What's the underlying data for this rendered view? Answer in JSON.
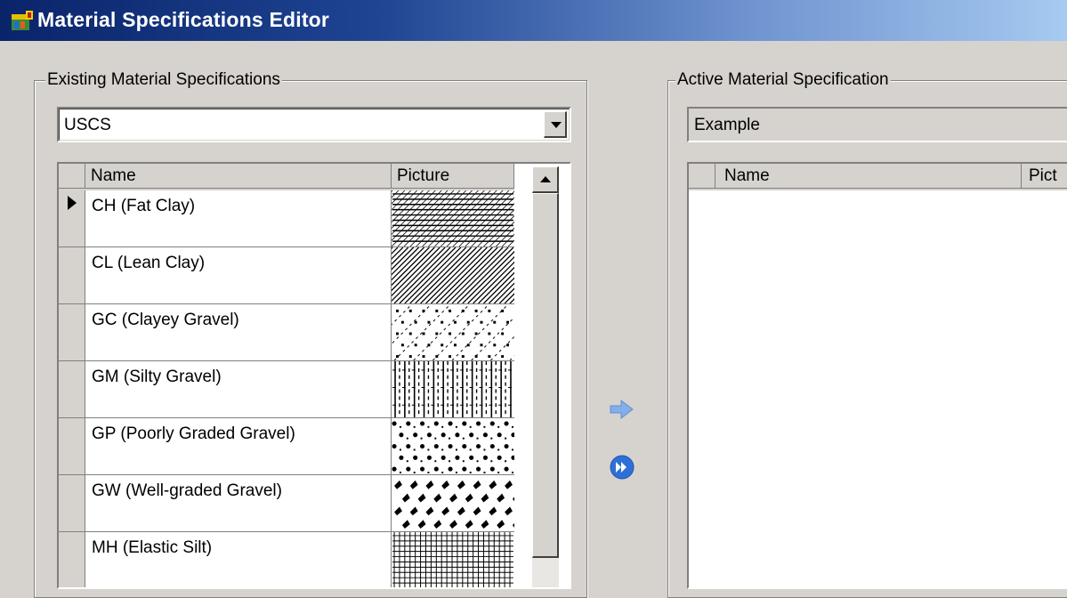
{
  "window": {
    "title": "Material Specifications Editor",
    "icon": "app-icon"
  },
  "existing": {
    "group_label": "Existing Material Specifications",
    "combo_value": "USCS",
    "columns": [
      "Name",
      "Picture"
    ],
    "rows": [
      {
        "name": "CH (Fat Clay)",
        "pattern": "horizontal-hatch",
        "selected": true
      },
      {
        "name": "CL (Lean Clay)",
        "pattern": "diagonal-hatch"
      },
      {
        "name": "GC (Clayey Gravel)",
        "pattern": "diagonal-dots"
      },
      {
        "name": "GM (Silty Gravel)",
        "pattern": "vertical-dashes"
      },
      {
        "name": "GP (Poorly Graded Gravel)",
        "pattern": "scattered-dots"
      },
      {
        "name": "GW (Well-graded Gravel)",
        "pattern": "scattered-blobs"
      },
      {
        "name": "MH (Elastic Silt)",
        "pattern": "grid"
      }
    ]
  },
  "transfer": {
    "add_icon": "arrow-right-icon",
    "add_all_icon": "fast-forward-icon",
    "accent": "#7da7e6"
  },
  "active": {
    "group_label": "Active Material Specification",
    "name_value": "Example",
    "columns": [
      "Name",
      "Pict"
    ]
  }
}
